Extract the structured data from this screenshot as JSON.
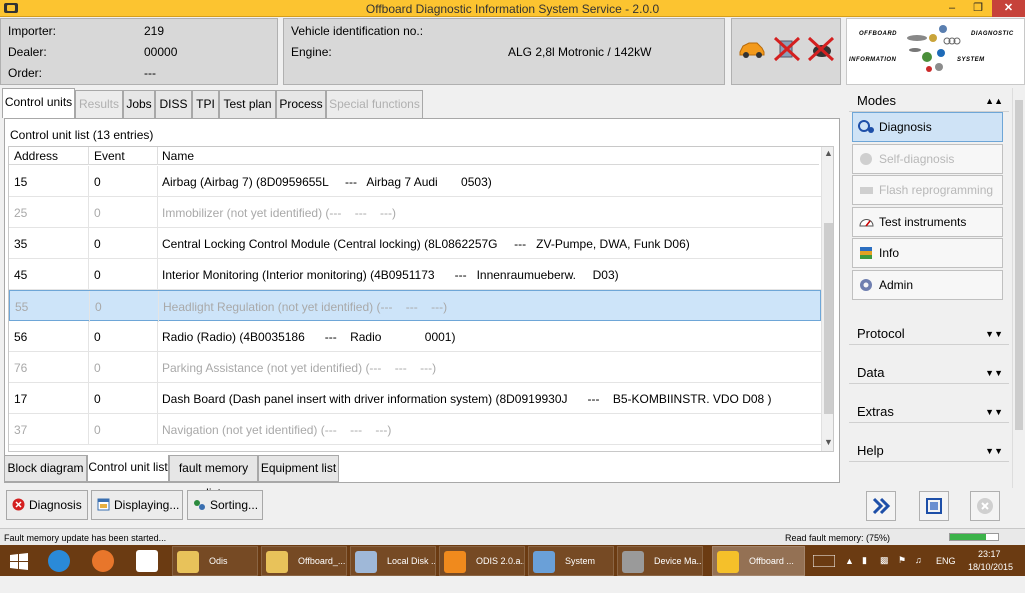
{
  "window": {
    "title": "Offboard Diagnostic Information System Service - 2.0.0",
    "minimize": "–",
    "maximize": "❐",
    "close": "✕"
  },
  "importer": {
    "label": "Importer:",
    "value": "219"
  },
  "dealer": {
    "label": "Dealer:",
    "value": "00000"
  },
  "order": {
    "label": "Order:",
    "value": "---"
  },
  "vehicle": {
    "vin_label": "Vehicle identification no.:",
    "vin_value": "",
    "engine_label": "Engine:",
    "engine_value": "ALG 2,8l Motronic / 142kW"
  },
  "logo": {
    "words": [
      "OFFBOARD",
      "DIAGNOSTIC",
      "INFORMATION",
      "SYSTEM"
    ]
  },
  "tabs": [
    {
      "label": "Control units",
      "state": "active"
    },
    {
      "label": "Results",
      "state": "disabled"
    },
    {
      "label": "Jobs",
      "state": "normal"
    },
    {
      "label": "DISS",
      "state": "normal"
    },
    {
      "label": "TPI",
      "state": "normal"
    },
    {
      "label": "Test plan",
      "state": "normal"
    },
    {
      "label": "Process",
      "state": "normal"
    },
    {
      "label": "Special functions",
      "state": "disabled"
    }
  ],
  "control_unit_list": {
    "header": "Control unit list (13 entries)",
    "columns": [
      "Address",
      "Event",
      "Name"
    ],
    "rows": [
      {
        "address": "15",
        "event": "0",
        "name": "Airbag (Airbag 7) (8D0959655L     ---   Airbag 7 Audi       0503)",
        "state": "normal"
      },
      {
        "address": "25",
        "event": "0",
        "name": "Immobilizer (not yet identified) (---    ---    ---)",
        "state": "dim"
      },
      {
        "address": "35",
        "event": "0",
        "name": "Central Locking Control Module (Central locking) (8L0862257G     ---   ZV-Pumpe, DWA, Funk D06)",
        "state": "normal"
      },
      {
        "address": "45",
        "event": "0",
        "name": "Interior Monitoring (Interior monitoring) (4B0951173      ---   Innenraumueberw.     D03)",
        "state": "normal"
      },
      {
        "address": "55",
        "event": "0",
        "name": "Headlight Regulation (not yet identified) (---    ---    ---)",
        "state": "selected"
      },
      {
        "address": "56",
        "event": "0",
        "name": "Radio (Radio) (4B0035186      ---    Radio             0001)",
        "state": "normal"
      },
      {
        "address": "76",
        "event": "0",
        "name": "Parking Assistance (not yet identified) (---    ---    ---)",
        "state": "dim"
      },
      {
        "address": "17",
        "event": "0",
        "name": "Dash Board (Dash panel insert with driver information system) (8D0919930J      ---    B5-KOMBIINSTR. VDO D08 )",
        "state": "normal"
      },
      {
        "address": "37",
        "event": "0",
        "name": "Navigation (not yet identified) (---    ---    ---)",
        "state": "dim"
      }
    ]
  },
  "bottom_tabs": [
    {
      "label": "Block diagram",
      "state": "normal"
    },
    {
      "label": "Control unit list",
      "state": "active"
    },
    {
      "label": "fault memory list",
      "state": "normal"
    },
    {
      "label": "Equipment list",
      "state": "normal"
    }
  ],
  "actions": {
    "diagnosis": "Diagnosis",
    "displaying": "Displaying...",
    "sorting": "Sorting..."
  },
  "sidebar": {
    "modes_label": "Modes",
    "modes": [
      {
        "label": "Diagnosis",
        "state": "active",
        "icon": "stethoscope-icon"
      },
      {
        "label": "Self-diagnosis",
        "state": "disabled",
        "icon": "self-diagnosis-icon"
      },
      {
        "label": "Flash reprogramming",
        "state": "disabled",
        "icon": "flash-icon"
      },
      {
        "label": "Test instruments",
        "state": "normal",
        "icon": "gauge-icon"
      },
      {
        "label": "Info",
        "state": "normal",
        "icon": "books-icon"
      },
      {
        "label": "Admin",
        "state": "normal",
        "icon": "gear-icon"
      }
    ],
    "protocol_label": "Protocol",
    "data_label": "Data",
    "extras_label": "Extras",
    "help_label": "Help"
  },
  "status": {
    "message": "Fault memory update has been started...",
    "progress_label": "Read fault memory: (75%)",
    "progress_fraction": 0.75
  },
  "taskbar": {
    "items": [
      {
        "label": "Odis",
        "icon": "folder-icon",
        "active": false
      },
      {
        "label": "Offboard_...",
        "icon": "folder-icon",
        "active": false
      },
      {
        "label": "Local Disk ...",
        "icon": "drive-icon",
        "active": false
      },
      {
        "label": "ODIS 2.0.a...",
        "icon": "vlc-icon",
        "active": false
      },
      {
        "label": "System",
        "icon": "system-icon",
        "active": false
      },
      {
        "label": "Device Ma...",
        "icon": "device-manager-icon",
        "active": false
      },
      {
        "label": "Offboard ...",
        "icon": "odis-icon",
        "active": true
      }
    ],
    "lang": "ENG",
    "time": "23:17",
    "date": "18/10/2015"
  },
  "colors": {
    "titlebar": "#fcc430",
    "selected_row": "#cde4f9",
    "taskbar": "#6b3b12",
    "error_red": "#d42020"
  }
}
